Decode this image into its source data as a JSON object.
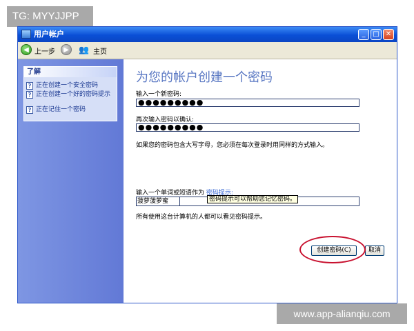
{
  "watermarks": {
    "top": "TG: MYYJJPP",
    "bottom": "www.app-alianqiu.com"
  },
  "window": {
    "title": "用户帐户",
    "controls": {
      "minimize": "_",
      "maximize": "□",
      "close": "✕"
    }
  },
  "toolbar": {
    "back_label": "上一步",
    "home_label": "主页"
  },
  "sidebar": {
    "panel_title": "了解",
    "items": [
      {
        "label": "正在创建一个安全密码"
      },
      {
        "label": "正在创建一个好的密码提示"
      },
      {
        "label": "正在记住一个密码"
      }
    ]
  },
  "main": {
    "heading": "为您的帐户创建一个密码",
    "new_password_label": "输入一个新密码:",
    "new_password_value": "●●●●●●●●●",
    "confirm_label": "再次输入密码以确认:",
    "confirm_value": "●●●●●●●●●",
    "case_note": "如果您的密码包含大写字母，您必须在每次登录时用同样的方式输入。",
    "hint_label": "输入一个单词或短语作为",
    "hint_link": "密码提示:",
    "hint_value": "菠萝菠萝蜜",
    "tooltip": "密码提示可以帮助您记忆密码。",
    "visibility_note": "所有使用这台计算机的人都可以看见密码提示。",
    "create_button": "创建密码(C)",
    "cancel_button": "取消"
  },
  "colors": {
    "highlight_ring": "#c8102e",
    "heading": "#5a78c3",
    "titlebar": "#0a4fd6"
  }
}
